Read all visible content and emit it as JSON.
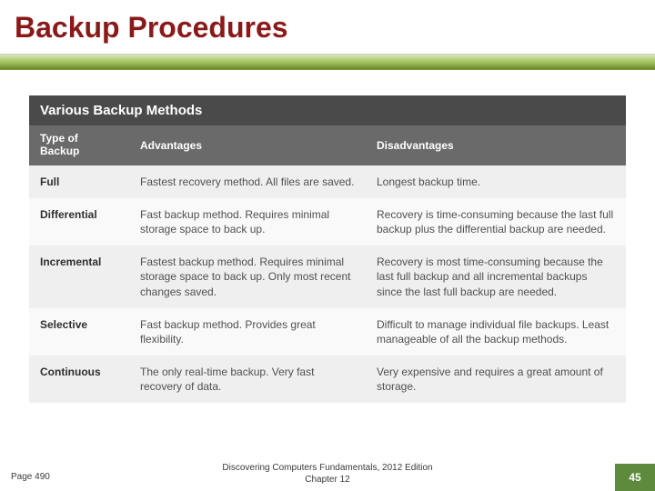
{
  "title": "Backup Procedures",
  "table": {
    "caption": "Various Backup Methods",
    "columns": {
      "type_line1": "Type of",
      "type_line2": "Backup",
      "advantages": "Advantages",
      "disadvantages": "Disadvantages"
    },
    "rows": [
      {
        "type": "Full",
        "advantages": "Fastest recovery method. All files are saved.",
        "disadvantages": "Longest backup time."
      },
      {
        "type": "Differential",
        "advantages": "Fast backup method. Requires minimal storage space to back up.",
        "disadvantages": "Recovery is time-consuming because the last full backup plus the differential backup are needed."
      },
      {
        "type": "Incremental",
        "advantages": "Fastest backup method. Requires minimal storage space to back up. Only most recent changes saved.",
        "disadvantages": "Recovery is most time-consuming because the last full backup and all incremental backups since the last full backup are needed."
      },
      {
        "type": "Selective",
        "advantages": "Fast backup method. Provides great flexibility.",
        "disadvantages": "Difficult to manage individual file backups. Least manageable of all the backup methods."
      },
      {
        "type": "Continuous",
        "advantages": "The only real-time backup. Very fast recovery of data.",
        "disadvantages": "Very expensive and requires a great amount of storage."
      }
    ]
  },
  "footer": {
    "page_ref": "Page 490",
    "center_line1": "Discovering Computers Fundamentals, 2012 Edition",
    "center_line2": "Chapter 12",
    "slide_number": "45"
  }
}
